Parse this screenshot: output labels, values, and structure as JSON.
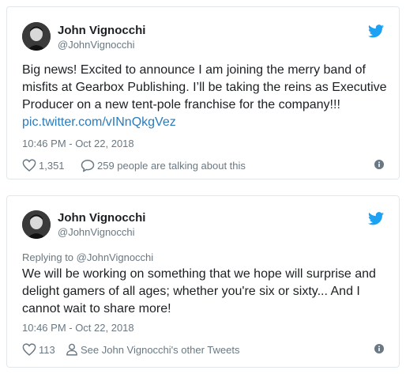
{
  "tweets": [
    {
      "author_name": "John Vignocchi",
      "author_handle": "@JohnVignocchi",
      "text_before_link": "Big news! Excited to announce I am joining the merry band of misfits at Gearbox Publishing. I’ll be taking the reins as Executive Producer on a new tent-pole franchise for the company!!! ",
      "link_text": "pic.twitter.com/vINnQkgVez",
      "timestamp": "10:46 PM - Oct 22, 2018",
      "likes": "1,351",
      "conversation_label": "259 people are talking about this"
    },
    {
      "author_name": "John Vignocchi",
      "author_handle": "@JohnVignocchi",
      "reply_prefix": "Replying to ",
      "reply_handle": "@JohnVignocchi",
      "text": "We will be working on something that we hope will surprise and delight gamers of all ages; whether you're six or sixty... And I cannot wait to share more!",
      "timestamp": "10:46 PM - Oct 22, 2018",
      "likes": "113",
      "profile_link_label": "See John Vignocchi's other Tweets"
    }
  ],
  "colors": {
    "text": "#1c2022",
    "secondary": "#697882",
    "link": "#2b7bb9",
    "twitter_blue": "#1da1f2",
    "border": "#e1e8ed"
  },
  "icons": {
    "brand": "twitter-bird-icon",
    "like": "heart-icon",
    "conversation": "speech-bubble-icon",
    "profile": "person-icon",
    "info": "info-icon"
  }
}
